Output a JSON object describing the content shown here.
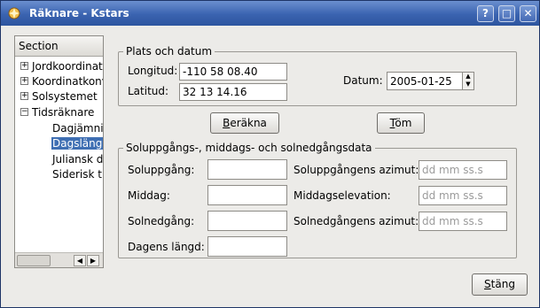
{
  "window": {
    "title": "Räknare - Kstars",
    "buttons": {
      "help": "?",
      "maximize": "□",
      "close": "✕"
    }
  },
  "sidebar": {
    "header": "Section",
    "items": [
      {
        "label": "Jordkoordinater",
        "level": 0,
        "expander": "+"
      },
      {
        "label": "Koordinatkonv",
        "level": 0,
        "expander": "+"
      },
      {
        "label": "Solsystemet",
        "level": 0,
        "expander": "+"
      },
      {
        "label": "Tidsräknare",
        "level": 0,
        "expander": "−"
      },
      {
        "label": "Dagjämningar",
        "level": 1
      },
      {
        "label": "Dagslängd",
        "level": 1,
        "selected": true
      },
      {
        "label": "Juliansk datum",
        "level": 1
      },
      {
        "label": "Siderisk tid",
        "level": 1
      }
    ]
  },
  "location": {
    "legend": "Plats och datum",
    "longitude_label": "Longitud:",
    "longitude_value": "-110 58 08.40",
    "latitude_label": "Latitud:",
    "latitude_value": "32 13 14.16",
    "date_label": "Datum:",
    "date_value": "2005-01-25"
  },
  "actions": {
    "compute": {
      "first": "B",
      "rest": "eräkna"
    },
    "clear": {
      "first": "T",
      "rest": "öm"
    }
  },
  "results": {
    "legend": "Soluppgångs-, middags- och solnedgångsdata",
    "sunrise_label": "Soluppgång:",
    "noon_label": "Middag:",
    "sunset_label": "Solnedgång:",
    "daylength_label": "Dagens längd:",
    "sunrise_az_label": "Soluppgångens azimut:",
    "noon_elev_label": "Middagselevation:",
    "sunset_az_label": "Solnedgångens azimut:",
    "placeholder": "dd mm ss.s"
  },
  "footer": {
    "close_first": "S",
    "close_rest": "täng"
  }
}
